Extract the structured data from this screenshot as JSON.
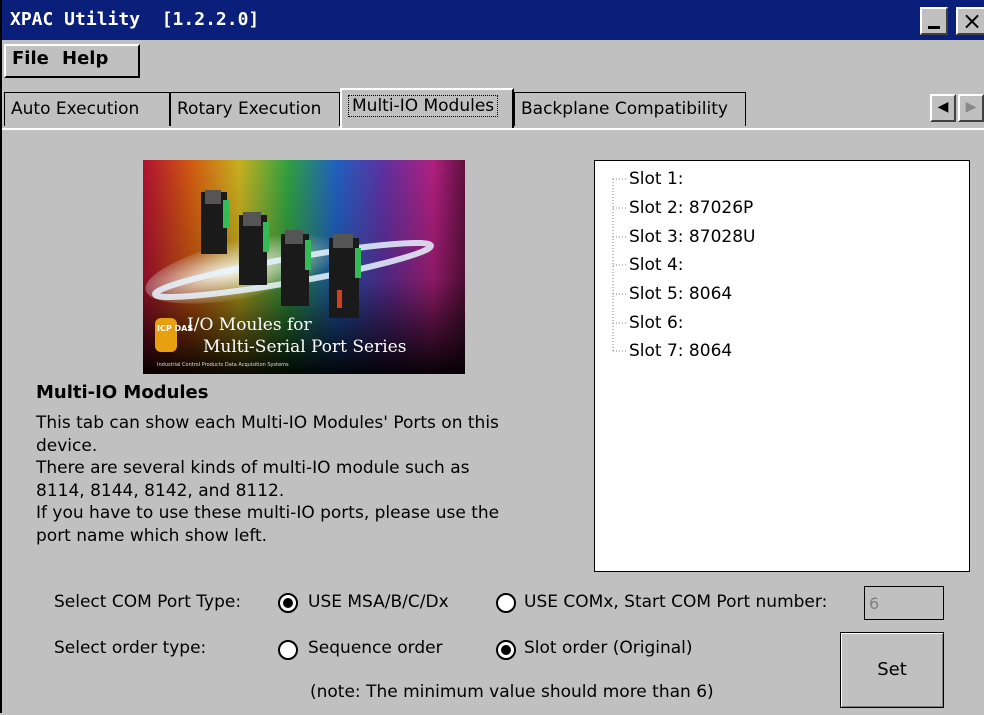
{
  "window": {
    "title": "XPAC Utility  [1.2.2.0]",
    "close_glyph": "×"
  },
  "menu": {
    "file": "File",
    "help": "Help"
  },
  "tabs": [
    {
      "label": "Auto Execution"
    },
    {
      "label": "Rotary Execution"
    },
    {
      "label": "Multi-IO Modules"
    },
    {
      "label": "Backplane Compatibility"
    }
  ],
  "tab_scroll": {
    "left": "◀",
    "right": "▶"
  },
  "banner": {
    "line1": "I/O Moules for",
    "line2": "Multi-Serial Port Series",
    "logo": "ICP DAS",
    "footer": "Industrial Control Products Data Acquisition Systems"
  },
  "heading": "Multi-IO Modules",
  "description": [
    "This tab can show each Multi-IO Modules' Ports on this",
    "device.",
    "There are several kinds of multi-IO module such as",
    "8114, 8144, 8142, and 8112.",
    "If you have to use these multi-IO ports, please use the",
    "port name which show left."
  ],
  "slots": [
    "Slot 1:",
    "Slot 2: 87026P",
    "Slot 3: 87028U",
    "Slot 4:",
    "Slot 5: 8064",
    "Slot 6:",
    "Slot 7: 8064"
  ],
  "com_port": {
    "label": "Select COM Port Type:",
    "option1": "USE MSA/B/C/Dx",
    "option2": "USE COMx, Start COM Port number:",
    "selected": "option1",
    "start_number": "6"
  },
  "order": {
    "label": "Select order type:",
    "option1": "Sequence order",
    "option2": "Slot order (Original)",
    "selected": "option2"
  },
  "note": "(note: The minimum value should more than 6)",
  "set_label": "Set",
  "colors": {
    "titlebar": "#0a1f7a",
    "face": "#c0c0c0"
  },
  "icons": {
    "minimize": "minimize-icon",
    "close": "close-icon"
  }
}
